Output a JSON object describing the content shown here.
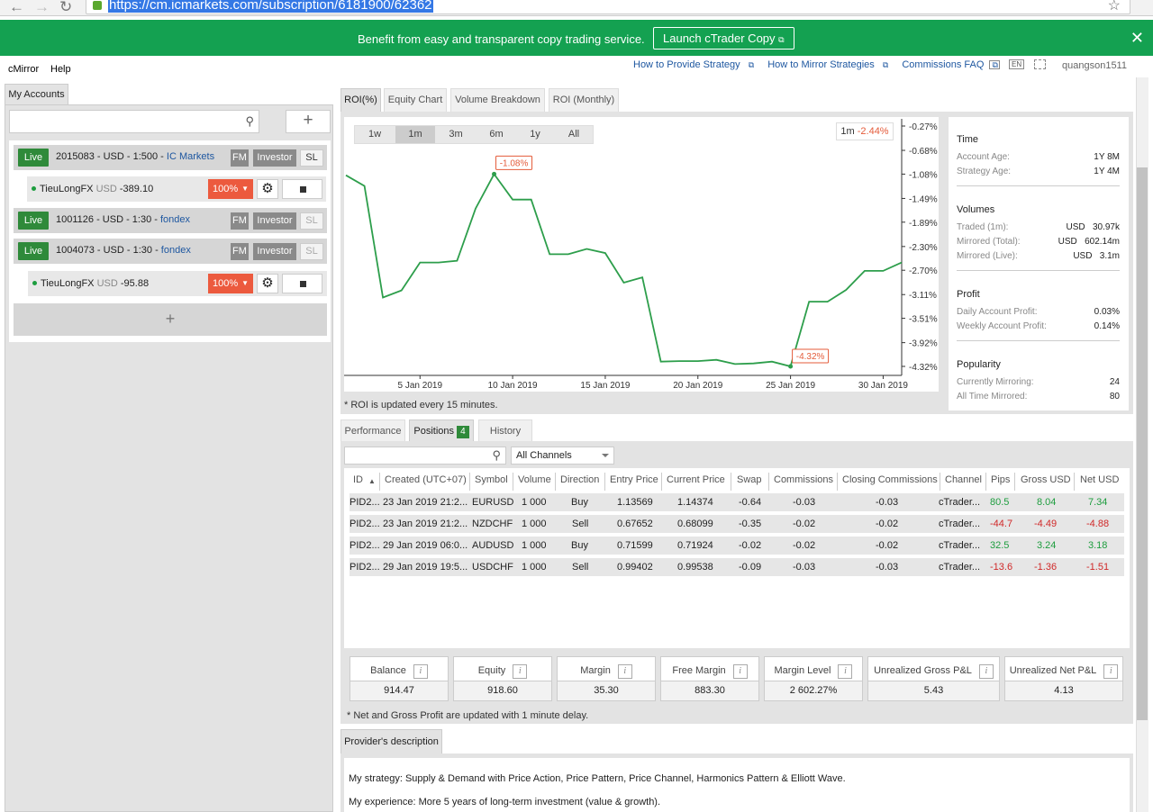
{
  "browser": {
    "url": "https://cm.icmarkets.com/subscription/6181900/62362"
  },
  "banner": {
    "text": "Benefit from easy and transparent copy trading service.",
    "button": "Launch cTrader Copy"
  },
  "menu": {
    "items": [
      "cMirror",
      "Help"
    ]
  },
  "toplinks": {
    "provide": "How to Provide Strategy",
    "mirror": "How to Mirror Strategies",
    "faq": "Commissions FAQ",
    "lang": "EN",
    "user": "quangson1511"
  },
  "left": {
    "tab": "My Accounts",
    "accounts": [
      {
        "badge": "Live",
        "text": "2015083 - USD - 1:500 - ",
        "broker": "IC Markets",
        "fm": "FM",
        "investor": "Investor",
        "sl": "SL",
        "sub": {
          "name": "TieuLongFX",
          "ccy": "USD",
          "value": "-389.10",
          "pct": "100%"
        }
      },
      {
        "badge": "Live",
        "text": "1001126 - USD - 1:30 - ",
        "broker": "fondex",
        "fm": "FM",
        "investor": "Investor",
        "sl": "SL"
      },
      {
        "badge": "Live",
        "text": "1004073 - USD - 1:30 - ",
        "broker": "fondex",
        "fm": "FM",
        "investor": "Investor",
        "sl": "SL",
        "sub": {
          "name": "TieuLongFX",
          "ccy": "USD",
          "value": "-95.88",
          "pct": "100%"
        }
      }
    ]
  },
  "chart_tabs": [
    "ROI(%)",
    "Equity Chart",
    "Volume Breakdown",
    "ROI (Monthly)"
  ],
  "ranges": [
    "1w",
    "1m",
    "3m",
    "6m",
    "1y",
    "All"
  ],
  "roi_label": {
    "period": "1m",
    "value": "-2.44%"
  },
  "roi_note": "* ROI is updated every 15 minutes.",
  "chart_data": {
    "type": "line",
    "x": [
      "2019-01-01",
      "2019-01-02",
      "2019-01-03",
      "2019-01-04",
      "2019-01-05",
      "2019-01-06",
      "2019-01-07",
      "2019-01-08",
      "2019-01-09",
      "2019-01-10",
      "2019-01-11",
      "2019-01-12",
      "2019-01-13",
      "2019-01-14",
      "2019-01-15",
      "2019-01-16",
      "2019-01-17",
      "2019-01-18",
      "2019-01-19",
      "2019-01-20",
      "2019-01-21",
      "2019-01-22",
      "2019-01-23",
      "2019-01-24",
      "2019-01-25",
      "2019-01-26",
      "2019-01-27",
      "2019-01-28",
      "2019-01-29",
      "2019-01-30",
      "2019-01-31"
    ],
    "values": [
      -1.1,
      -1.28,
      -3.16,
      -3.04,
      -2.57,
      -2.57,
      -2.54,
      -1.66,
      -1.08,
      -1.51,
      -1.51,
      -2.43,
      -2.43,
      -2.34,
      -2.41,
      -2.91,
      -2.82,
      -4.24,
      -4.23,
      -4.23,
      -4.21,
      -4.28,
      -4.27,
      -4.24,
      -4.32,
      -3.23,
      -3.23,
      -3.03,
      -2.71,
      -2.71,
      -2.57
    ],
    "markers": [
      {
        "x": "2019-01-09",
        "label": "-1.08%"
      },
      {
        "x": "2019-01-25",
        "label": "-4.32%"
      }
    ],
    "y_ticks": [
      "-0.27%",
      "-0.68%",
      "-1.08%",
      "-1.49%",
      "-1.89%",
      "-2.30%",
      "-2.70%",
      "-3.11%",
      "-3.51%",
      "-3.92%",
      "-4.32%"
    ],
    "x_ticks": [
      {
        "x": "2019-01-05",
        "label": "5 Jan 2019"
      },
      {
        "x": "2019-01-10",
        "label": "10 Jan 2019"
      },
      {
        "x": "2019-01-15",
        "label": "15 Jan 2019"
      },
      {
        "x": "2019-01-20",
        "label": "20 Jan 2019"
      },
      {
        "x": "2019-01-25",
        "label": "25 Jan 2019"
      },
      {
        "x": "2019-01-30",
        "label": "30 Jan 2019"
      }
    ],
    "ylim": [
      -4.32,
      -0.27
    ],
    "color": "#2d9e4b"
  },
  "stats": {
    "time": {
      "title": "Time",
      "rows": [
        [
          "Account Age:",
          "1Y 8M"
        ],
        [
          "Strategy Age:",
          "1Y 4M"
        ]
      ]
    },
    "volumes": {
      "title": "Volumes",
      "rows": [
        [
          "Traded (1m):",
          "USD   30.97k"
        ],
        [
          "Mirrored (Total):",
          "USD   602.14m"
        ],
        [
          "Mirrored (Live):",
          "USD   3.1m"
        ]
      ]
    },
    "profit": {
      "title": "Profit",
      "rows": [
        [
          "Daily Account Profit:",
          "0.03%"
        ],
        [
          "Weekly Account Profit:",
          "0.14%"
        ]
      ]
    },
    "popularity": {
      "title": "Popularity",
      "rows": [
        [
          "Currently Mirroring:",
          "24"
        ],
        [
          "All Time Mirrored:",
          "80"
        ]
      ]
    }
  },
  "pos_tabs": {
    "performance": "Performance",
    "positions": "Positions",
    "count": "4",
    "history": "History"
  },
  "channel_select": "All Channels",
  "table": {
    "headers": [
      "ID",
      "Created (UTC+07)",
      "Symbol",
      "Volume",
      "Direction",
      "Entry Price",
      "Current Price",
      "Swap",
      "Commissions",
      "Closing Commissions",
      "Channel",
      "Pips",
      "Gross USD",
      "Net USD"
    ],
    "rows": [
      [
        "PID2...",
        "23 Jan 2019 21:2...",
        "EURUSD",
        "1 000",
        "Buy",
        "1.13569",
        "1.14374",
        "-0.64",
        "-0.03",
        "-0.03",
        "cTrader...",
        "80.5",
        "8.04",
        "7.34"
      ],
      [
        "PID2...",
        "23 Jan 2019 21:2...",
        "NZDCHF",
        "1 000",
        "Sell",
        "0.67652",
        "0.68099",
        "-0.35",
        "-0.02",
        "-0.02",
        "cTrader...",
        "-44.7",
        "-4.49",
        "-4.88"
      ],
      [
        "PID2...",
        "29 Jan 2019 06:0...",
        "AUDUSD",
        "1 000",
        "Buy",
        "0.71599",
        "0.71924",
        "-0.02",
        "-0.02",
        "-0.02",
        "cTrader...",
        "32.5",
        "3.24",
        "3.18"
      ],
      [
        "PID2...",
        "29 Jan 2019 19:5...",
        "USDCHF",
        "1 000",
        "Sell",
        "0.99402",
        "0.99538",
        "-0.09",
        "-0.03",
        "-0.03",
        "cTrader...",
        "-13.6",
        "-1.36",
        "-1.51"
      ]
    ]
  },
  "summary": [
    {
      "label": "Balance",
      "value": "914.47"
    },
    {
      "label": "Equity",
      "value": "918.60"
    },
    {
      "label": "Margin",
      "value": "35.30"
    },
    {
      "label": "Free Margin",
      "value": "883.30"
    },
    {
      "label": "Margin Level",
      "value": "2 602.27%"
    },
    {
      "label": "Unrealized Gross P&L",
      "value": "5.43"
    },
    {
      "label": "Unrealized Net P&L",
      "value": "4.13"
    }
  ],
  "net_note": "* Net and Gross Profit are updated with 1 minute delay.",
  "desc": {
    "tab": "Provider's description",
    "line1": "My strategy: Supply & Demand with Price Action, Price Pattern, Price Channel, Harmonics Pattern & Elliott Wave.",
    "line2": "My experience: More 5 years of long-term investment (value & growth)."
  }
}
